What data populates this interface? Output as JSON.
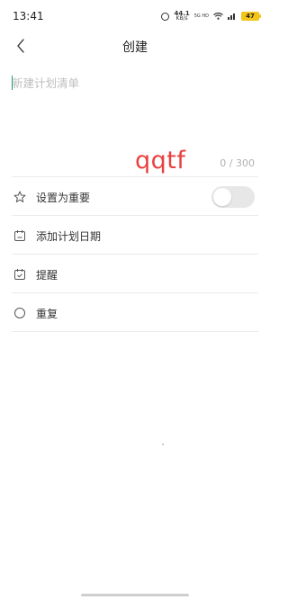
{
  "status_bar": {
    "time": "13:41",
    "net_speed_value": "44.1",
    "net_speed_unit": "KB/s",
    "signal_label": "5G HD",
    "battery": "47"
  },
  "header": {
    "title": "创建",
    "back_icon": "chevron-left-icon"
  },
  "editor": {
    "placeholder": "新建计划清单",
    "value": "",
    "char_count": "0 / 300"
  },
  "watermark": "qqtf",
  "options": [
    {
      "icon": "star-icon",
      "label": "设置为重要",
      "has_toggle": true,
      "toggle_on": false
    },
    {
      "icon": "calendar-icon",
      "label": "添加计划日期"
    },
    {
      "icon": "calendar-check-icon",
      "label": "提醒"
    },
    {
      "icon": "circle-icon",
      "label": "重复"
    }
  ],
  "colors": {
    "caret": "#1aa37a",
    "watermark": "#e9403f",
    "battery": "#f3c41a",
    "toggle_off": "#e7e7e7"
  }
}
